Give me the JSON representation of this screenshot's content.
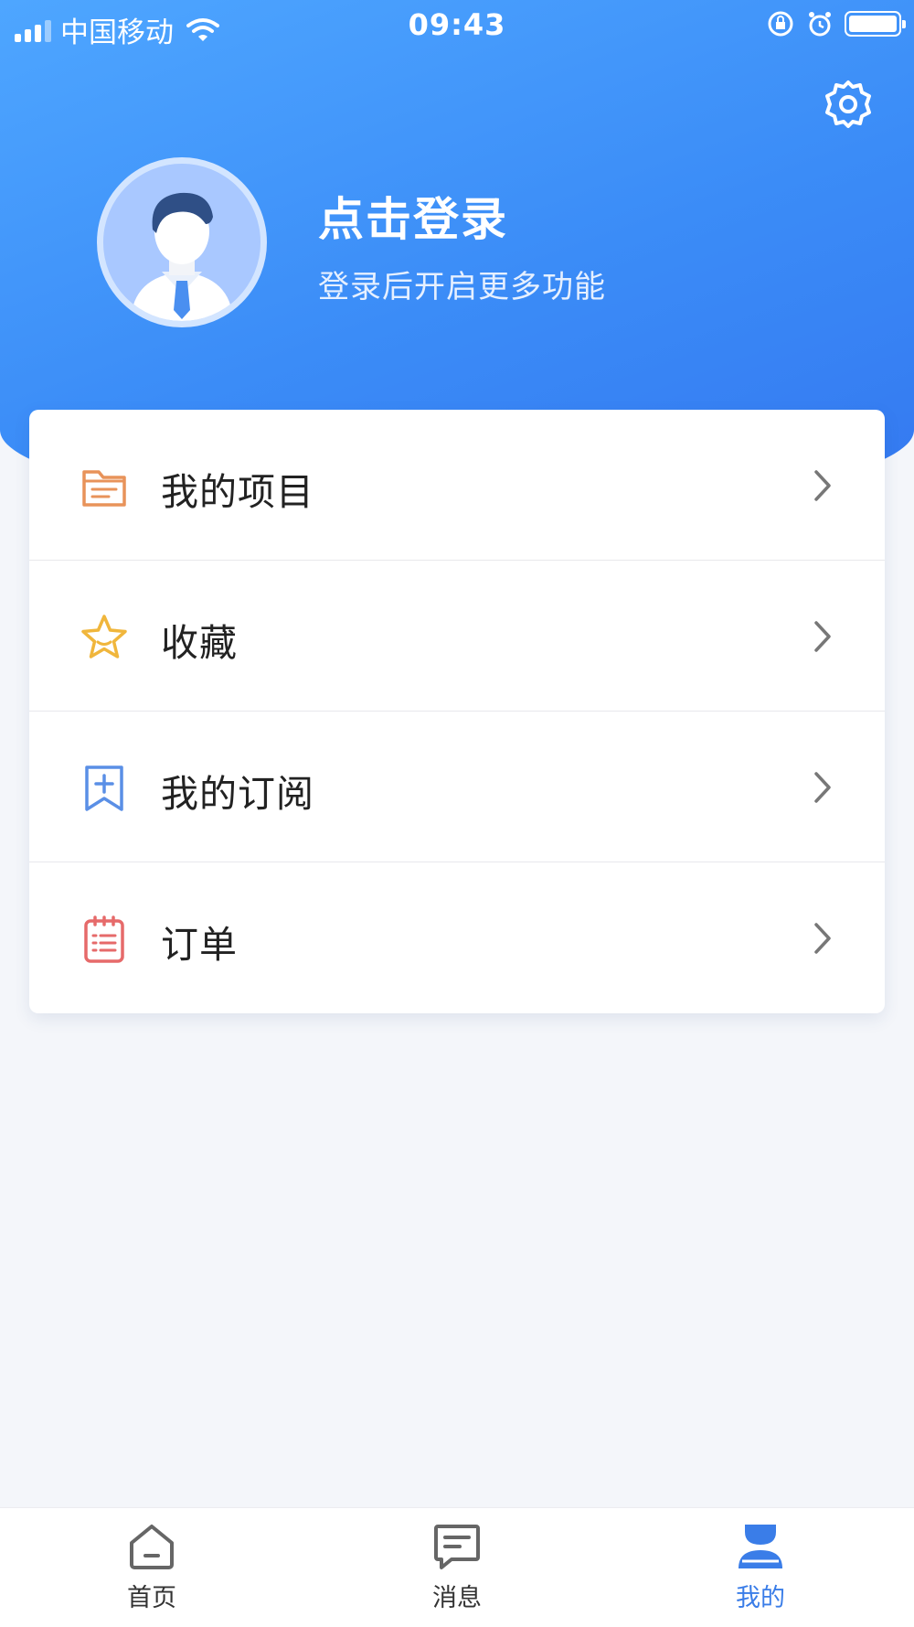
{
  "status_bar": {
    "carrier": "中国移动",
    "time": "09:43"
  },
  "header": {
    "title": "点击登录",
    "subtitle": "登录后开启更多功能",
    "settings_icon": "gear-icon",
    "avatar_icon": "user-avatar-icon"
  },
  "menu": {
    "items": [
      {
        "label": "我的项目",
        "icon": "folder-icon",
        "color": "#e8935a"
      },
      {
        "label": "收藏",
        "icon": "star-icon",
        "color": "#f0b63c"
      },
      {
        "label": "我的订阅",
        "icon": "bookmark-plus-icon",
        "color": "#5a8fe6"
      },
      {
        "label": "订单",
        "icon": "order-list-icon",
        "color": "#e66a6a"
      }
    ]
  },
  "tabbar": {
    "tabs": [
      {
        "label": "首页",
        "icon": "home-icon",
        "active": false
      },
      {
        "label": "消息",
        "icon": "message-icon",
        "active": false
      },
      {
        "label": "我的",
        "icon": "profile-icon",
        "active": true
      }
    ]
  },
  "colors": {
    "primary": "#3b8cf7",
    "active_tab": "#3a7de8",
    "background": "#f4f6fa"
  }
}
